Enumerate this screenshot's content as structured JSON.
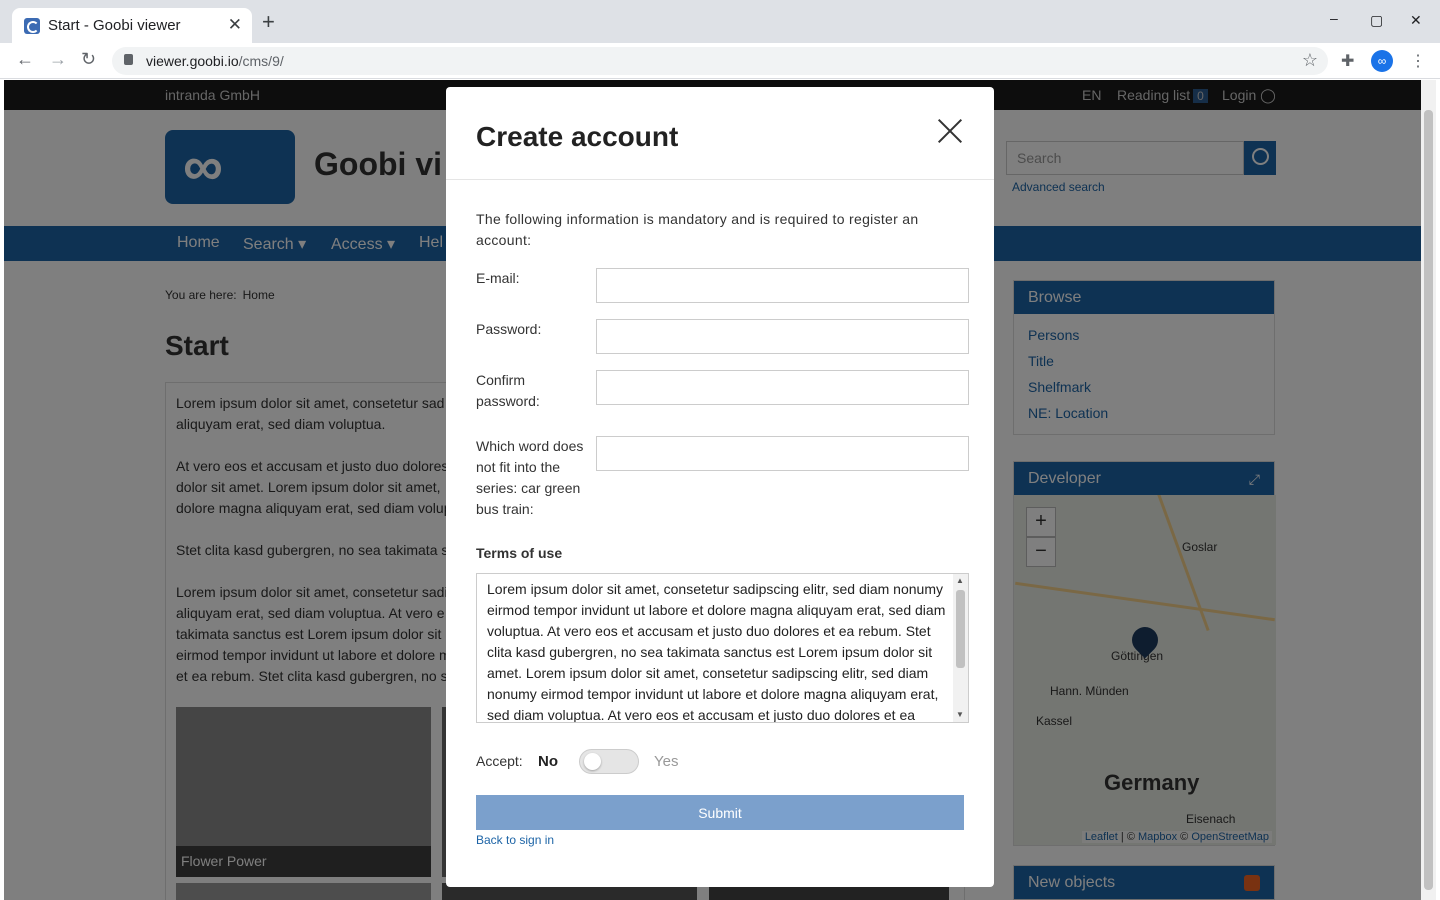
{
  "browser": {
    "tab_title": "Start - Goobi viewer",
    "tab_close": "✕",
    "new_tab": "+",
    "url_host": "viewer.goobi.io",
    "url_path": "/cms/9/",
    "profile": "∞"
  },
  "site": {
    "org": "intranda GmbH",
    "lang": "EN",
    "reading_list_label": "Reading list",
    "reading_list_count": "0",
    "login_label": "Login",
    "logo_glyph": "∞",
    "title": "Goobi vi",
    "search_placeholder": "Search",
    "advanced_search": "Advanced search",
    "nav": [
      "Home",
      "Search",
      "Access",
      "Hel"
    ],
    "breadcrumb_prefix": "You are here:",
    "breadcrumb_home": "Home",
    "page_title": "Start",
    "paragraphs": [
      "Lorem ipsum dolor sit amet, consetetur sad",
      "aliquyam erat, sed diam voluptua.",
      "At vero eos et accusam et justo duo dolores",
      "dolor sit amet. Lorem ipsum dolor sit amet,",
      "dolore magna aliquyam erat, sed diam volup",
      "Stet clita kasd gubergren, no sea takimata s",
      "Lorem ipsum dolor sit amet, consetetur sadi",
      "aliquyam erat, sed diam voluptua. At vero e",
      "takimata sanctus est Lorem ipsum dolor sit",
      "eirmod tempor invidunt ut labore et dolore m",
      "et ea rebum. Stet clita kasd gubergren, no s"
    ],
    "thumb_label": "Flower Power",
    "browse": {
      "title": "Browse",
      "items": [
        "Persons",
        "Title",
        "Shelfmark",
        "NE: Location"
      ]
    },
    "developer": {
      "title": "Developer",
      "zoom_in": "+",
      "zoom_out": "−",
      "cities": [
        "Goslar",
        "Göttingen",
        "Hann. Münden",
        "Kassel",
        "Eisenach"
      ],
      "country": "Germany",
      "attribution_leaflet": "Leaflet",
      "attribution_mapbox": "Mapbox",
      "attribution_osm": "OpenStreetMap"
    },
    "new_objects": "New objects"
  },
  "modal": {
    "title": "Create account",
    "intro": "The following information is mandatory and is required to register an account:",
    "fields": {
      "email_label": "E-mail:",
      "email_value": "",
      "password_label": "Password:",
      "password_value": "",
      "confirm_label": "Confirm password:",
      "confirm_value": "",
      "captcha_label": "Which word does not fit into the series: car green bus train:",
      "captcha_value": ""
    },
    "terms_heading": "Terms of use",
    "terms_text": "Lorem ipsum dolor sit amet, consetetur sadipscing elitr, sed diam nonumy eirmod tempor invidunt ut labore et dolore magna aliquyam erat, sed diam voluptua. At vero eos et accusam et justo duo dolores et ea rebum. Stet clita kasd gubergren, no sea takimata sanctus est Lorem ipsum dolor sit amet. Lorem ipsum dolor sit amet, consetetur sadipscing elitr, sed diam nonumy eirmod tempor invidunt ut labore et dolore magna aliquyam erat, sed diam voluptua. At vero eos et accusam et justo duo dolores et ea rebum.",
    "accept_label": "Accept:",
    "accept_no": "No",
    "accept_yes": "Yes",
    "accept_state": "No",
    "submit_label": "Submit",
    "back_link": "Back to sign in"
  },
  "colors": {
    "brand": "#1d64a6",
    "submit": "#7ba0cc",
    "overlay": "rgba(0,0,0,0.5)"
  }
}
